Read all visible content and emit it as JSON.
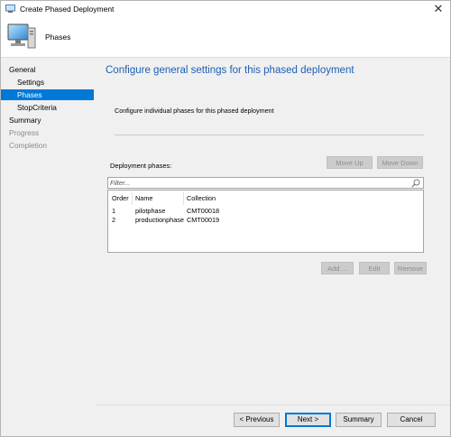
{
  "window": {
    "title": "Create Phased Deployment",
    "close_glyph": "✕"
  },
  "header": {
    "page_name": "Phases"
  },
  "nav": {
    "items": [
      {
        "label": "General"
      },
      {
        "label": "Settings"
      },
      {
        "label": "Phases"
      },
      {
        "label": "StopCriteria"
      },
      {
        "label": "Summary"
      },
      {
        "label": "Progress"
      },
      {
        "label": "Completion"
      }
    ]
  },
  "main": {
    "heading": "Configure general settings for this phased deployment",
    "description": "Configure individual phases for this phased deployment",
    "phases_label": "Deployment phases:",
    "move_up_label": "Move Up",
    "move_down_label": "Move Down",
    "filter_placeholder": "Filter...",
    "columns": [
      "Order",
      "Name",
      "Collection"
    ],
    "rows": [
      {
        "order": "1",
        "name": "pilotphase",
        "collection": "CMT00018"
      },
      {
        "order": "2",
        "name": "productionphase",
        "collection": "CMT00019"
      }
    ],
    "add_label": "Add ...",
    "edit_label": "Edit",
    "remove_label": "Remove"
  },
  "footer": {
    "previous_label": "< Previous",
    "next_label": "Next >",
    "summary_label": "Summary",
    "cancel_label": "Cancel"
  },
  "colors": {
    "accent": "#0078d7",
    "heading": "#1d5fb5",
    "nav_selected": "#0078d7"
  },
  "icons": {
    "app": "computer-wizard-icon",
    "header": "computer-monitor-icon",
    "filter": "search-icon"
  }
}
